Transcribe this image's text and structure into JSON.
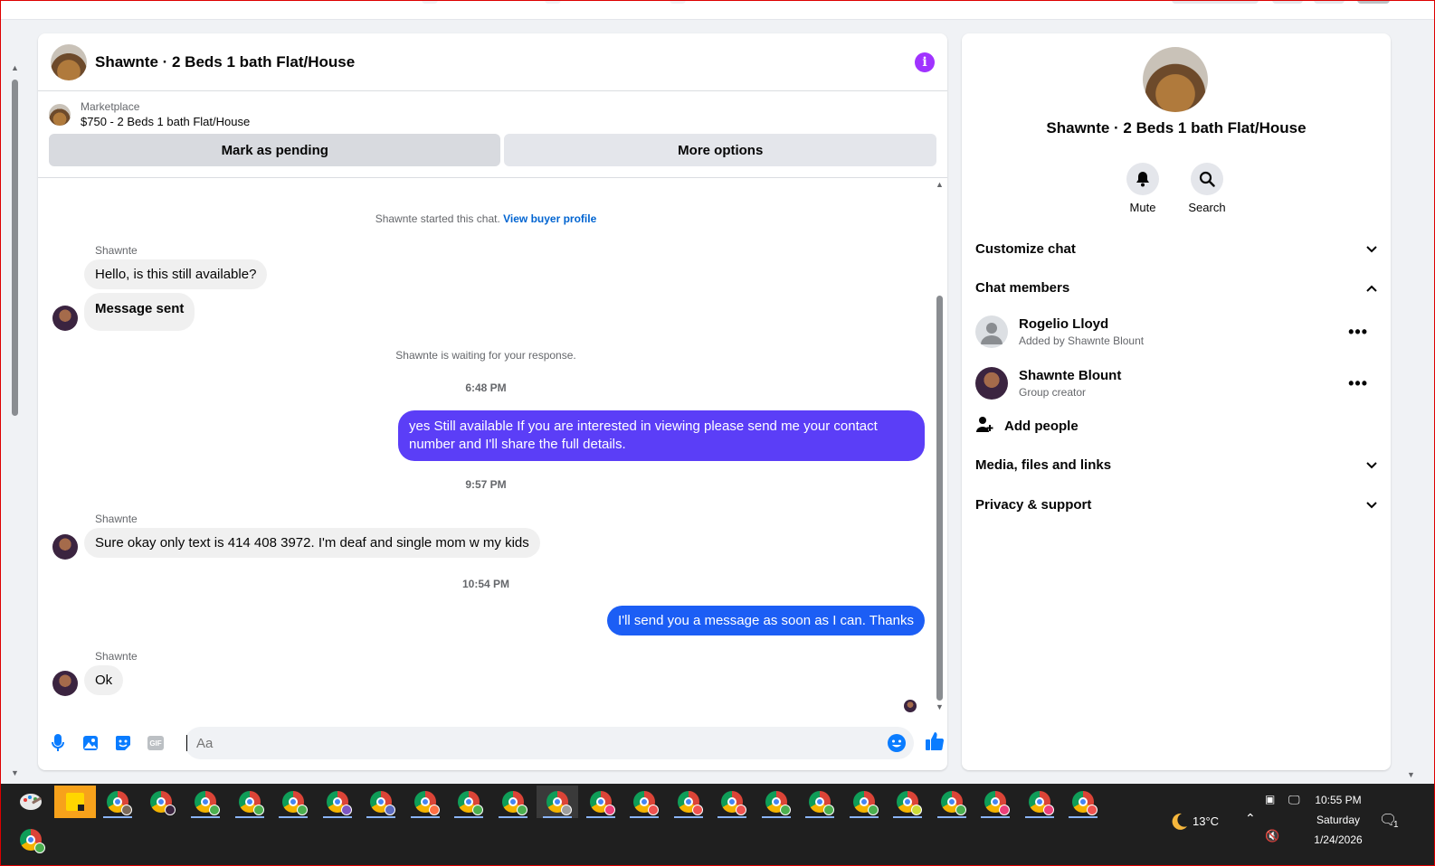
{
  "chat": {
    "title": "Shawnte · 2 Beds 1 bath Flat/House",
    "listing_label": "Marketplace",
    "listing_price": "$750 - 2 Beds 1 bath Flat/House",
    "btn_pending": "Mark as pending",
    "btn_more": "More options",
    "started_text": "Shawnte started this chat.",
    "view_profile": "View buyer profile",
    "waiting_text": "Shawnte is waiting for your response.",
    "composer_placeholder": "Aa"
  },
  "messages": [
    {
      "sender": "Shawnte",
      "text": "Hello, is this still available?"
    },
    {
      "text": "Message sent"
    },
    {
      "time": "6:48 PM"
    },
    {
      "text": "yes Still available If you are interested in viewing please send me your contact number and I'll share the full details."
    },
    {
      "time": "9:57 PM"
    },
    {
      "sender": "Shawnte",
      "text": "Sure okay only text is 414 408 3972. I'm deaf and single mom w my kids"
    },
    {
      "time": "10:54 PM"
    },
    {
      "text": "I'll send you a message as soon as I can. Thanks"
    },
    {
      "sender": "Shawnte",
      "text": "Ok"
    }
  ],
  "info": {
    "name": "Shawnte · 2 Beds 1 bath Flat/House",
    "mute": "Mute",
    "search": "Search",
    "customize": "Customize chat",
    "members_title": "Chat members",
    "members": [
      {
        "name": "Rogelio Lloyd",
        "sub": "Added by Shawnte Blount"
      },
      {
        "name": "Shawnte Blount",
        "sub": "Group creator"
      }
    ],
    "add_people": "Add people",
    "media": "Media, files and links",
    "privacy": "Privacy & support"
  },
  "colors": {
    "accent_purple": "#5b3ef7",
    "accent_blue": "#1c5ef5",
    "info_purple": "#a033ff"
  },
  "taskbar": {
    "weather": "13°C",
    "time": "10:55 PM",
    "day": "Saturday",
    "date": "1/24/2026",
    "notifications": "1"
  }
}
